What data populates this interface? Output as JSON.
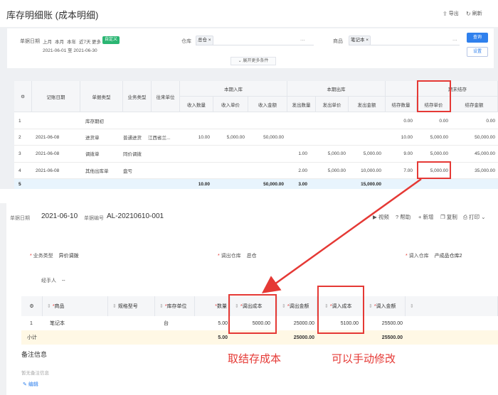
{
  "top_panel": {
    "title": "库存明细账 (成本明细)",
    "actions": [
      {
        "label": "导出",
        "icon": "export-icon"
      },
      {
        "label": "刷新",
        "icon": "refresh-icon"
      }
    ],
    "filters": {
      "date_label": "单据日期",
      "date_chips": [
        "上月",
        "本月",
        "本年",
        "近7天",
        "更多"
      ],
      "custom_chip": "自定义",
      "date_range": "2021-06-01 至 2021-06-30",
      "warehouse_label": "仓库",
      "warehouse_tag": "总仓 ×",
      "product_label": "商品",
      "product_tag": "笔记本 ×",
      "ellipsis": "...",
      "query_button": "查询",
      "settings_button": "设置",
      "expand_label": "展开更多条件"
    },
    "grid": {
      "headers": {
        "settings": "⚙",
        "date": "记账日期",
        "doc_type": "单据类型",
        "biz_type": "业务类型",
        "partner": "往来单位",
        "in_group": "本期入库",
        "out_group": "本期出库",
        "end_group": "期末结存",
        "in_qty": "收入数量",
        "in_price": "收入单价",
        "in_amount": "收入金额",
        "out_qty": "发出数量",
        "out_price": "发出单价",
        "out_amount": "发出金额",
        "end_qty": "结存数量",
        "end_price": "结存单价",
        "end_amount": "结存金额"
      },
      "rows": [
        {
          "no": "1",
          "date": "",
          "doc_type": "库存期初",
          "biz_type": "",
          "partner": "",
          "in_qty": "",
          "in_price": "",
          "in_amount": "",
          "out_qty": "",
          "out_price": "",
          "out_amount": "",
          "end_qty": "0.00",
          "end_price": "0.00",
          "end_amount": "0.00"
        },
        {
          "no": "2",
          "date": "2021-06-08",
          "doc_type": "进货单",
          "biz_type": "普通进货",
          "partner": "江西省兰...",
          "in_qty": "10.00",
          "in_price": "5,000.00",
          "in_amount": "50,000.00",
          "out_qty": "",
          "out_price": "",
          "out_amount": "",
          "end_qty": "10.00",
          "end_price": "5,000.00",
          "end_amount": "50,000.00"
        },
        {
          "no": "3",
          "date": "2021-06-08",
          "doc_type": "调拨单",
          "biz_type": "同价调拨",
          "partner": "",
          "in_qty": "",
          "in_price": "",
          "in_amount": "",
          "out_qty": "1.00",
          "out_price": "5,000.00",
          "out_amount": "5,000.00",
          "end_qty": "9.00",
          "end_price": "5,000.00",
          "end_amount": "45,000.00"
        },
        {
          "no": "4",
          "date": "2021-06-08",
          "doc_type": "其他出库单",
          "biz_type": "盘亏",
          "partner": "",
          "in_qty": "",
          "in_price": "",
          "in_amount": "",
          "out_qty": "2.00",
          "out_price": "5,000.00",
          "out_amount": "10,000.00",
          "end_qty": "7.00",
          "end_price": "5,000.00",
          "end_amount": "35,000.00"
        }
      ],
      "total": {
        "no": "5",
        "in_qty": "10.00",
        "in_amount": "50,000.00",
        "out_qty": "3.00",
        "out_amount": "15,000.00"
      }
    }
  },
  "bottom_panel": {
    "doc_date_label": "单据日期",
    "doc_date": "2021-06-10",
    "doc_no_label": "单据编号",
    "doc_no": "AL-20210610-001",
    "toolbar": [
      "视频",
      "帮助",
      "+ 新增",
      "复制",
      "打印"
    ],
    "form": {
      "biz_type_label": "业务类型",
      "biz_type_value": "异价调拨",
      "out_wh_label": "调出仓库",
      "out_wh_value": "总仓",
      "in_wh_label": "调入仓库",
      "in_wh_value": "产成品仓库2",
      "handler_label": "经手人",
      "handler_value": "--"
    },
    "grid": {
      "headers": {
        "product": "商品",
        "spec": "规格型号",
        "unit": "库存单位",
        "qty": "数量",
        "out_cost": "调出成本",
        "out_amount": "调出金额",
        "in_cost": "调入成本",
        "in_amount": "调入金额"
      },
      "row": {
        "no": "1",
        "product": "笔记本",
        "unit": "台",
        "qty": "5.00",
        "out_cost": "5000.00",
        "out_amount": "25000.00",
        "in_cost": "5100.00",
        "in_amount": "25500.00"
      },
      "subtotal": {
        "label": "小计",
        "qty": "5.00",
        "out_amount": "25000.00",
        "in_amount": "25500.00"
      }
    },
    "remarks_title": "备注信息",
    "remarks_empty": "暂无备注信息",
    "edit_label": "编辑"
  },
  "annotations": {
    "left": "取结存成本",
    "right": "可以手动修改"
  },
  "colors": {
    "highlight": "#e53935",
    "primary": "#2f80ed",
    "green": "#2bb673"
  }
}
